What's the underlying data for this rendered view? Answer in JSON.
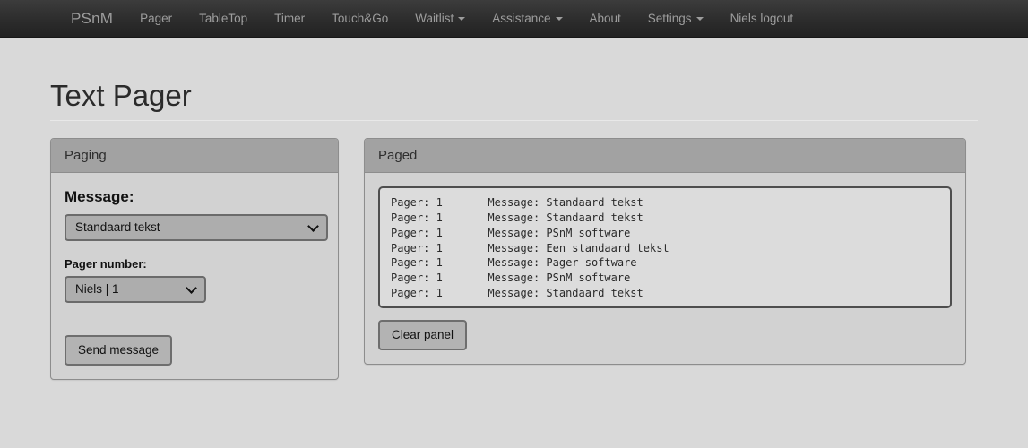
{
  "navbar": {
    "brand": "PSnM",
    "items": [
      {
        "label": "Pager",
        "caret": false,
        "icon": ""
      },
      {
        "label": "TableTop",
        "caret": false,
        "icon": ""
      },
      {
        "label": "Timer",
        "caret": false,
        "icon": ""
      },
      {
        "label": "Touch&Go",
        "caret": false,
        "icon": ""
      },
      {
        "label": "Waitlist",
        "caret": true,
        "icon": "caret-down-icon"
      },
      {
        "label": "Assistance",
        "caret": true,
        "icon": "caret-down-icon"
      },
      {
        "label": "About",
        "caret": false,
        "icon": ""
      },
      {
        "label": "Settings",
        "caret": true,
        "icon": "caret-down-icon"
      },
      {
        "label": "Niels logout",
        "caret": false,
        "icon": ""
      }
    ]
  },
  "page": {
    "title": "Text Pager"
  },
  "paging_panel": {
    "title": "Paging",
    "message_label": "Message:",
    "message_select": {
      "value": "Standaard tekst",
      "icon": "chevron-down-icon"
    },
    "pager_label": "Pager number:",
    "pager_select": {
      "value": "Niels | 1",
      "icon": "chevron-down-icon"
    },
    "send_button": "Send message"
  },
  "paged_panel": {
    "title": "Paged",
    "log_lines": [
      "Pager: 1       Message: Standaard tekst",
      "Pager: 1       Message: Standaard tekst",
      "Pager: 1       Message: PSnM software",
      "Pager: 1       Message: Een standaard tekst",
      "Pager: 1       Message: Pager software",
      "Pager: 1       Message: PSnM software",
      "Pager: 1       Message: Standaard tekst"
    ],
    "clear_button": "Clear panel"
  },
  "colors": {
    "navbar_top": "#3c3c3c",
    "navbar_bottom": "#222222",
    "nav_text": "#9d9d9d",
    "page_bg": "#d9d9d9",
    "panel_bg": "#d2d2d2",
    "panel_heading_bg": "#a2a2a2",
    "panel_border": "#8d8d8d",
    "control_bg": "#adadad",
    "control_border": "#6b6b6b",
    "log_bg": "#dcdcdc",
    "log_border": "#4e4e4e",
    "text": "#2b2b2b"
  }
}
